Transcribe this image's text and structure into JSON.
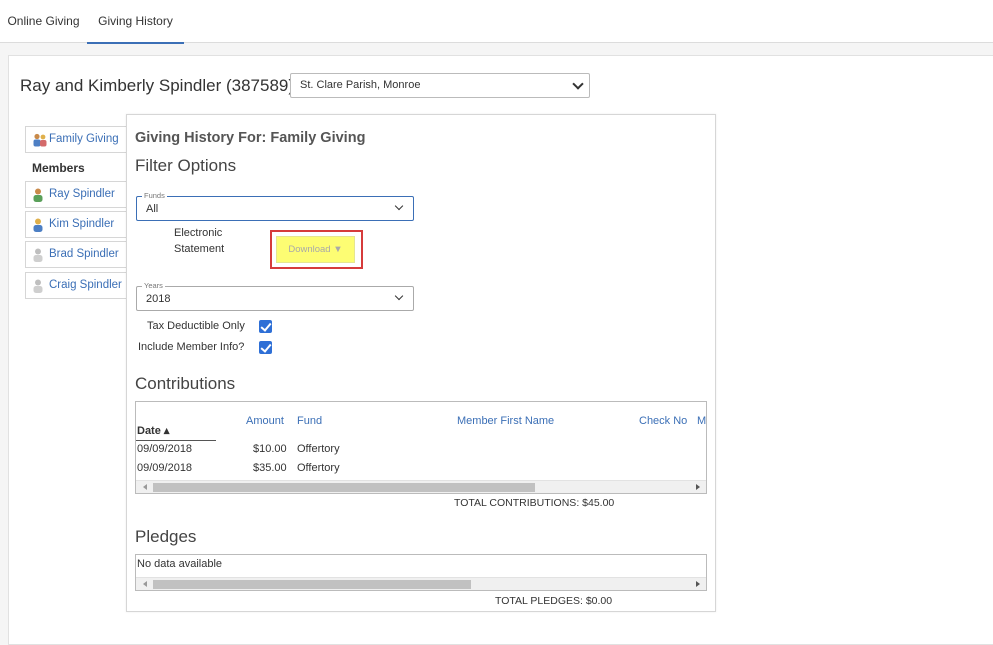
{
  "tabs": [
    {
      "label": "Online Giving"
    },
    {
      "label": "Giving History"
    }
  ],
  "header": {
    "family_name": "Ray and Kimberly Spindler (387589)",
    "parish_selected": "St. Clare Parish, Monroe"
  },
  "sidebar": {
    "family_item": "Family Giving",
    "members_label": "Members",
    "members": [
      {
        "label": "Ray Spindler"
      },
      {
        "label": "Kim Spindler"
      },
      {
        "label": "Brad Spindler"
      },
      {
        "label": "Craig Spindler"
      }
    ]
  },
  "panel": {
    "title": "Giving History For: Family Giving",
    "filter_heading": "Filter Options",
    "funds": {
      "label": "Funds",
      "value": "All"
    },
    "electronic_statement_line1": "Electronic",
    "electronic_statement_line2": "Statement",
    "download_label": "Download ▼",
    "years": {
      "label": "Years",
      "value": "2018"
    },
    "tax_deductible_label": "Tax Deductible Only",
    "include_member_label": "Include Member Info?",
    "contributions_heading": "Contributions",
    "pledges_heading": "Pledges"
  },
  "contributions": {
    "columns": {
      "date": "Date ▴",
      "amount": "Amount",
      "fund": "Fund",
      "member_first_name": "Member First Name",
      "check_no": "Check No",
      "partial": "M"
    },
    "rows": [
      {
        "date": "09/09/2018",
        "amount": "$10.00",
        "fund": "Offertory"
      },
      {
        "date": "09/09/2018",
        "amount": "$35.00",
        "fund": "Offertory"
      }
    ],
    "total": "TOTAL CONTRIBUTIONS: $45.00"
  },
  "pledges": {
    "empty_text": "No data available",
    "total": "TOTAL PLEDGES: $0.00"
  },
  "colors": {
    "accent": "#3b6fb6",
    "highlight": "#fdfd73",
    "outline_red": "#d63b3b",
    "checkbox": "#2e6fd6"
  }
}
